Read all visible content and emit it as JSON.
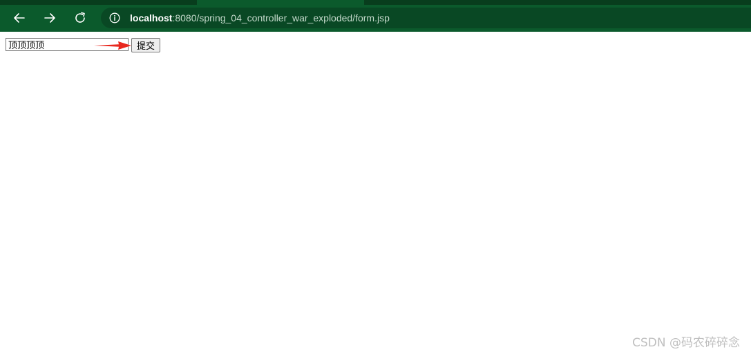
{
  "browser": {
    "url_host": "localhost",
    "url_path": ":8080/spring_04_controller_war_exploded/form.jsp",
    "icons": {
      "back": "arrow-left-icon",
      "forward": "arrow-right-icon",
      "reload": "reload-icon",
      "info": "info-icon"
    },
    "colors": {
      "chrome": "#0b5a2c",
      "address_bar": "#094824"
    }
  },
  "form": {
    "input_value": "顶顶顶顶",
    "submit_label": "提交"
  },
  "annotation": {
    "arrow_color": "#e8281e"
  },
  "watermark": {
    "text": "CSDN @码农碎碎念"
  }
}
